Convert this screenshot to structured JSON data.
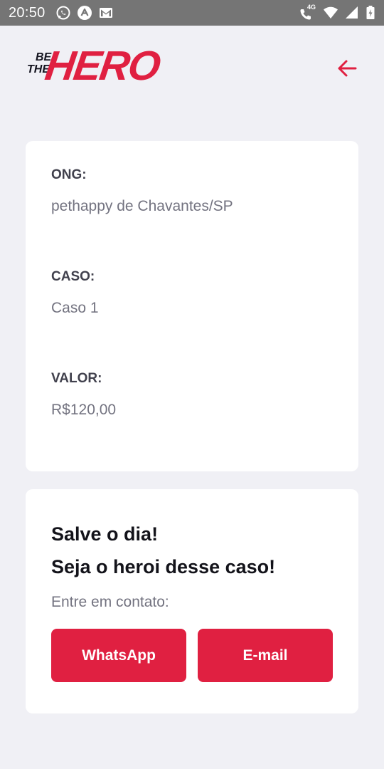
{
  "status_bar": {
    "time": "20:50",
    "network_label": "4G",
    "left_icons": [
      "whatsapp-icon",
      "app-notification-icon",
      "gmail-icon"
    ],
    "right_icons": [
      "call-4g-icon",
      "wifi-icon",
      "signal-icon",
      "battery-charging-icon"
    ]
  },
  "header": {
    "logo": {
      "be": "BE",
      "the": "THE",
      "hero": "HERO"
    },
    "back_icon": "arrow-left-icon"
  },
  "incident": {
    "ong_label": "ONG:",
    "ong_value": "pethappy de Chavantes/SP",
    "caso_label": "CASO:",
    "caso_value": "Caso 1",
    "valor_label": "VALOR:",
    "valor_value": "R$120,00"
  },
  "contact": {
    "title_line1": "Salve o dia!",
    "title_line2": "Seja o heroi desse caso!",
    "description": "Entre em contato:",
    "whatsapp_label": "WhatsApp",
    "email_label": "E-mail"
  },
  "colors": {
    "accent": "#e02041",
    "background": "#f0f0f5",
    "card": "#ffffff",
    "status_bar": "#757575",
    "label_text": "#41414d",
    "value_text": "#737380",
    "title_text": "#13131a"
  }
}
